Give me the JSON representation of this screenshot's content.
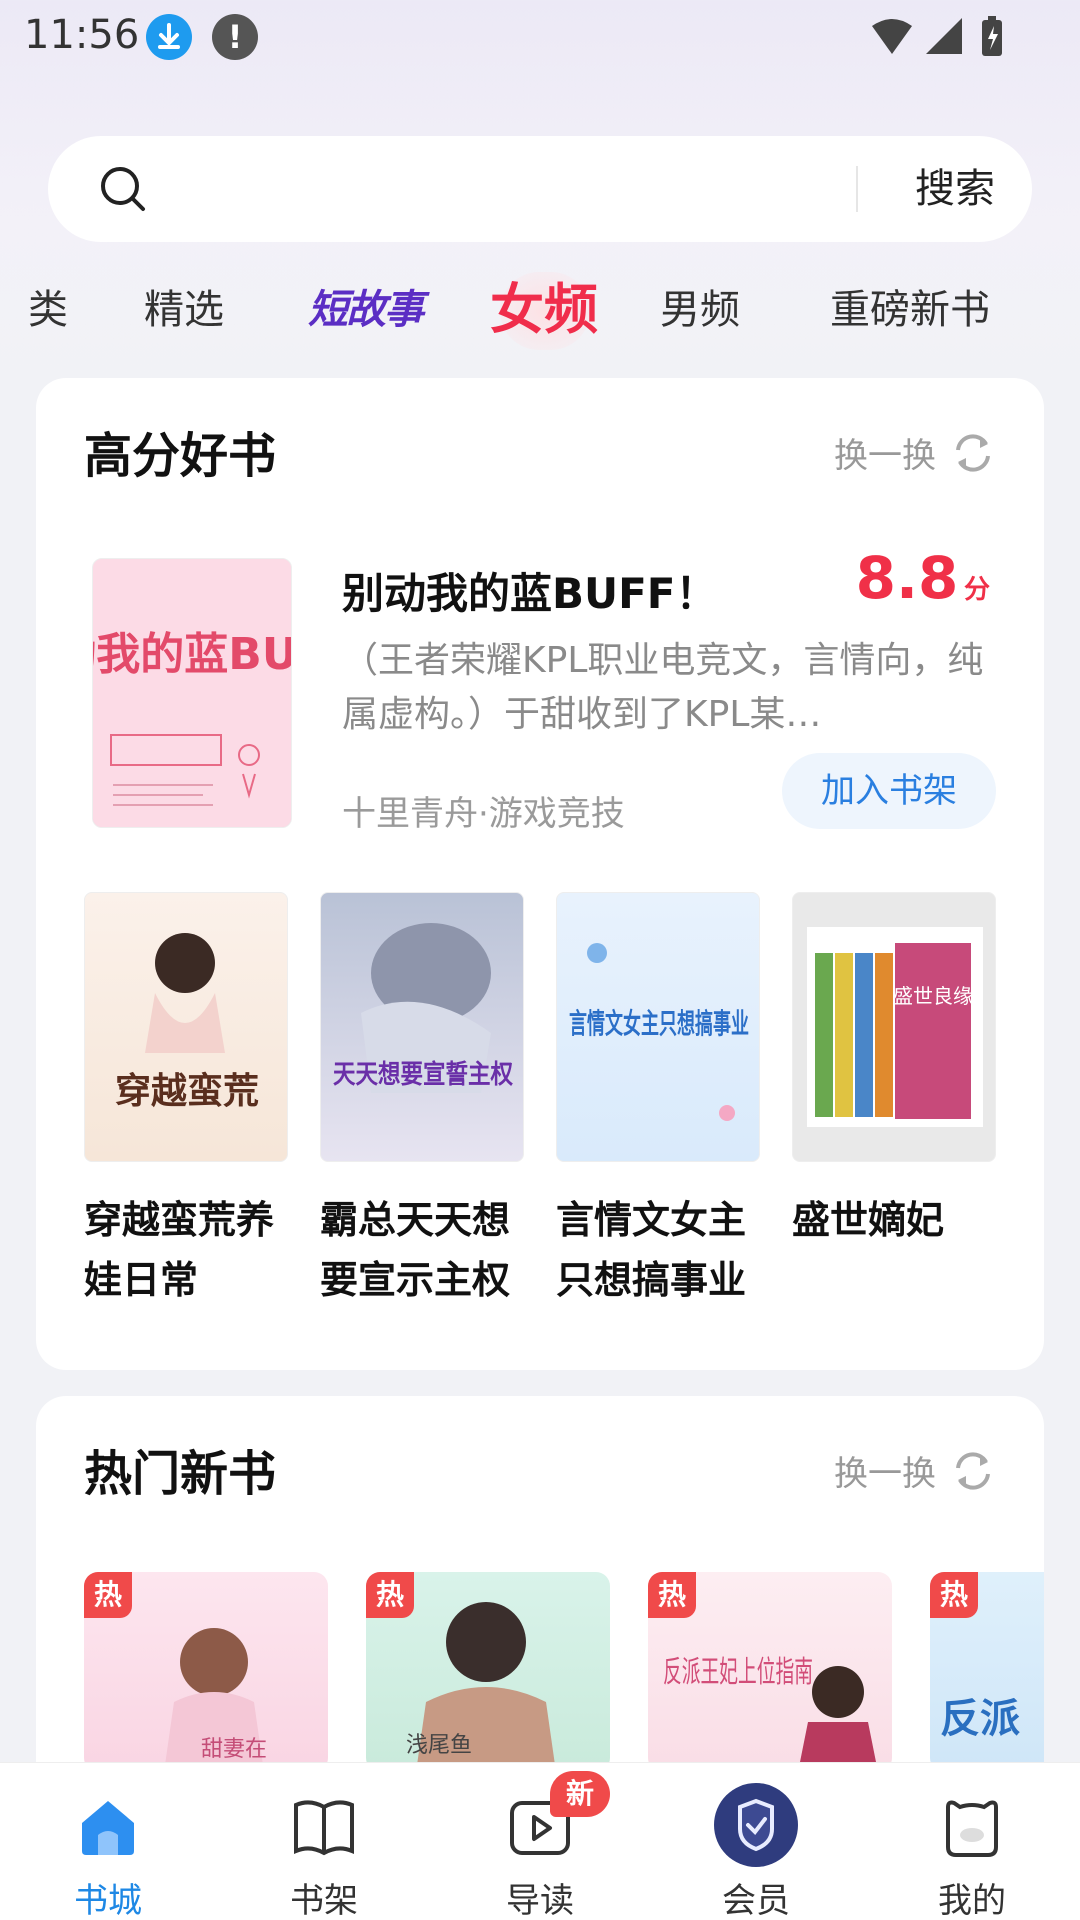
{
  "status_bar": {
    "time": "11:56"
  },
  "search": {
    "button_label": "搜索",
    "placeholder": ""
  },
  "tabs": [
    {
      "label": "类"
    },
    {
      "label": "精选"
    },
    {
      "label": "短故事"
    },
    {
      "label": "女频",
      "active": true
    },
    {
      "label": "男频"
    },
    {
      "label": "重磅新书"
    }
  ],
  "high_score_section": {
    "title": "高分好书",
    "refresh_label": "换一换",
    "featured": {
      "title": "别动我的蓝BUFF！",
      "score": "8.8",
      "score_unit": "分",
      "description": "（王者荣耀KPL职业电竞文，言情向，纯属虚构。）于甜收到了KPL某…",
      "meta": "十里青舟·游戏竞技",
      "add_label": "加入书架",
      "cover_text": "别动我的蓝BUFF!"
    },
    "books": [
      {
        "title": "穿越蛮荒养娃日常",
        "cover_text": "穿越蛮荒"
      },
      {
        "title": "霸总天天想要宣示主权",
        "cover_text": "天天想要宣誓主权"
      },
      {
        "title": "言情文女主只想搞事业",
        "cover_text": "言情文女主只想搞事业"
      },
      {
        "title": "盛世嫡妃",
        "cover_text": "盛世良缘"
      }
    ]
  },
  "hot_new_section": {
    "title": "热门新书",
    "refresh_label": "换一换",
    "badge": "热",
    "books": [
      {
        "cover_text": "甜妻在"
      },
      {
        "cover_text": "浅尾鱼"
      },
      {
        "cover_text": "反派王妃上位指南"
      },
      {
        "cover_text": "反派"
      }
    ]
  },
  "bottom_nav": [
    {
      "label": "书城",
      "active": true
    },
    {
      "label": "书架"
    },
    {
      "label": "导读",
      "badge": "新"
    },
    {
      "label": "会员"
    },
    {
      "label": "我的"
    }
  ],
  "colors": {
    "accent": "#1e88e5",
    "score": "#f03048",
    "tab_active": "#f02d4b"
  }
}
